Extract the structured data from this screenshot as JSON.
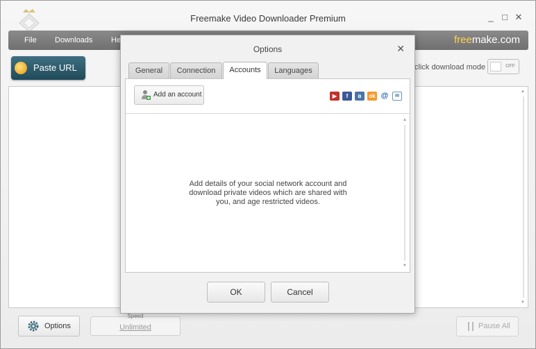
{
  "window": {
    "title": "Freemake Video Downloader Premium",
    "controls": [
      "_",
      "□",
      "✕"
    ]
  },
  "menu": {
    "items": [
      "File",
      "Downloads",
      "He"
    ],
    "brand_a": "free",
    "brand_b": "make.com"
  },
  "toolbar": {
    "paste_url": "Paste URL",
    "mode_label": "click download mode",
    "toggle_state": "OFF"
  },
  "footer": {
    "options": "Options",
    "speed_caption": "Speed",
    "speed_value": "Unlimited",
    "pause_all": "Pause All"
  },
  "dialog": {
    "title": "Options",
    "close": "✕",
    "tabs": [
      "General",
      "Connection",
      "Accounts",
      "Languages"
    ],
    "active_tab": "Accounts",
    "add_account": "Add an account",
    "social_icons": [
      "youtube-icon",
      "facebook-icon",
      "vkontakte-icon",
      "odnoklassniki-icon",
      "mailru-icon",
      "email-icon"
    ],
    "message": "Add details of your social network account and download private videos which are shared with you, and age restricted videos.",
    "ok": "OK",
    "cancel": "Cancel"
  },
  "colors": {
    "accent": "#2a5566",
    "brand_yellow": "#ffd34d",
    "menubar": "#7c7c7c"
  }
}
